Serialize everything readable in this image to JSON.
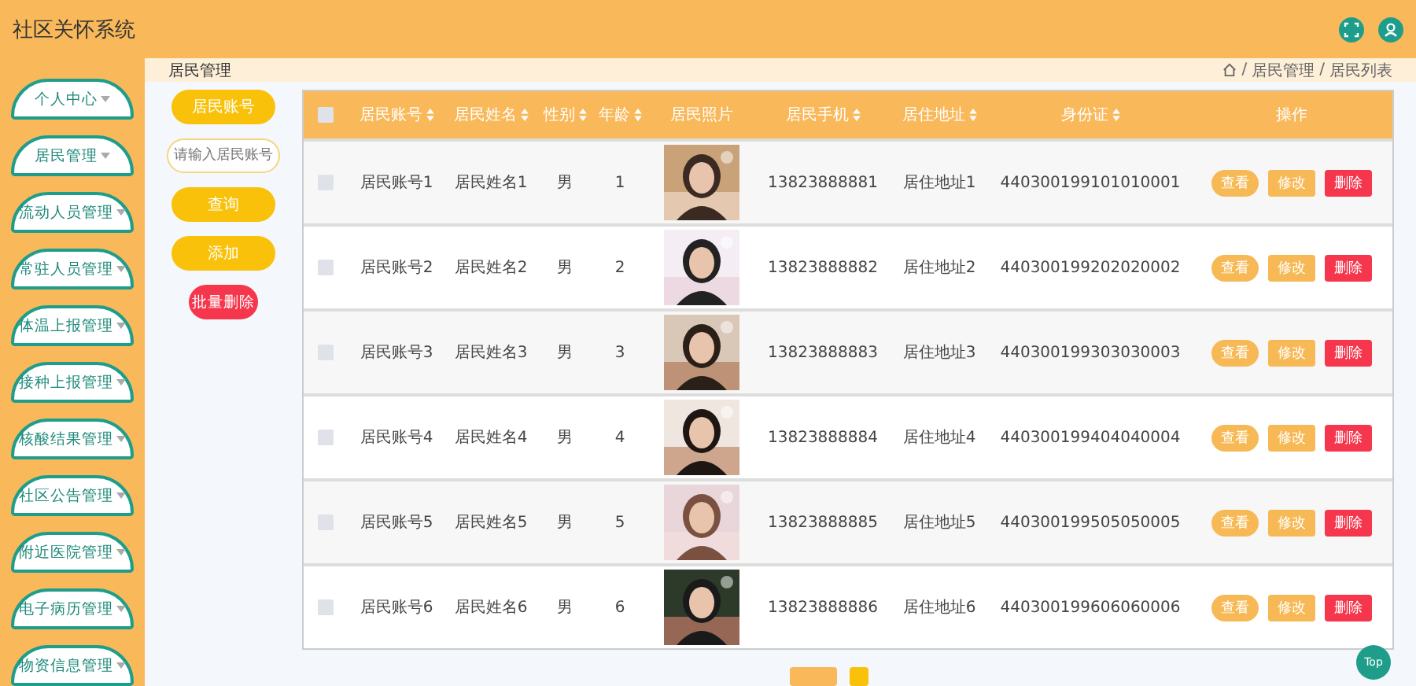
{
  "header": {
    "title": "社区关怀系统"
  },
  "sidebar": {
    "items": [
      {
        "label": "个人中心"
      },
      {
        "label": "居民管理"
      },
      {
        "label": "流动人员管理"
      },
      {
        "label": "常驻人员管理"
      },
      {
        "label": "体温上报管理"
      },
      {
        "label": "接种上报管理"
      },
      {
        "label": "核酸结果管理"
      },
      {
        "label": "社区公告管理"
      },
      {
        "label": "附近医院管理"
      },
      {
        "label": "电子病历管理"
      },
      {
        "label": "物资信息管理"
      }
    ]
  },
  "page_title": "居民管理",
  "breadcrumb": {
    "separator": "/",
    "items": [
      "居民管理",
      "居民列表"
    ]
  },
  "search": {
    "label": "居民账号",
    "placeholder": "请输入居民账号"
  },
  "actions": [
    {
      "label": "查询",
      "kind": "primary"
    },
    {
      "label": "添加",
      "kind": "primary"
    },
    {
      "label": "批量删除",
      "kind": "danger"
    }
  ],
  "table": {
    "select_all": {
      "checked": false
    },
    "columns": [
      {
        "label": "居民账号",
        "sortable": true
      },
      {
        "label": "居民姓名",
        "sortable": true
      },
      {
        "label": "性别",
        "sortable": true
      },
      {
        "label": "年龄",
        "sortable": true
      },
      {
        "label": "居民照片",
        "sortable": false
      },
      {
        "label": "居民手机",
        "sortable": true
      },
      {
        "label": "居住地址",
        "sortable": true
      },
      {
        "label": "身份证",
        "sortable": true
      },
      {
        "label": "操作",
        "sortable": false
      }
    ],
    "rows": [
      {
        "checked": false,
        "cells": [
          "居民账号1",
          "居民姓名1",
          "男",
          "1",
          {
            "kind": "picture"
          },
          "13823888881",
          "居住地址1",
          "440300199101010001"
        ],
        "buttons": [
          "查看",
          "修改",
          "删除"
        ]
      },
      {
        "checked": false,
        "cells": [
          "居民账号2",
          "居民姓名2",
          "男",
          "2",
          {
            "kind": "picture"
          },
          "13823888882",
          "居住地址2",
          "440300199202020002"
        ],
        "buttons": [
          "查看",
          "修改",
          "删除"
        ]
      },
      {
        "checked": false,
        "cells": [
          "居民账号3",
          "居民姓名3",
          "男",
          "3",
          {
            "kind": "picture"
          },
          "13823888883",
          "居住地址3",
          "440300199303030003"
        ],
        "buttons": [
          "查看",
          "修改",
          "删除"
        ]
      },
      {
        "checked": false,
        "cells": [
          "居民账号4",
          "居民姓名4",
          "男",
          "4",
          {
            "kind": "picture"
          },
          "13823888884",
          "居住地址4",
          "440300199404040004"
        ],
        "buttons": [
          "查看",
          "修改",
          "删除"
        ]
      },
      {
        "checked": false,
        "cells": [
          "居民账号5",
          "居民姓名5",
          "男",
          "5",
          {
            "kind": "picture"
          },
          "13823888885",
          "居住地址5",
          "440300199505050005"
        ],
        "buttons": [
          "查看",
          "修改",
          "删除"
        ]
      },
      {
        "checked": false,
        "cells": [
          "居民账号6",
          "居民姓名6",
          "男",
          "6",
          {
            "kind": "picture"
          },
          "13823888886",
          "居住地址6",
          "440300199606060006"
        ],
        "buttons": [
          "查看",
          "修改",
          "删除"
        ]
      }
    ]
  },
  "back_to_top": "Top"
}
